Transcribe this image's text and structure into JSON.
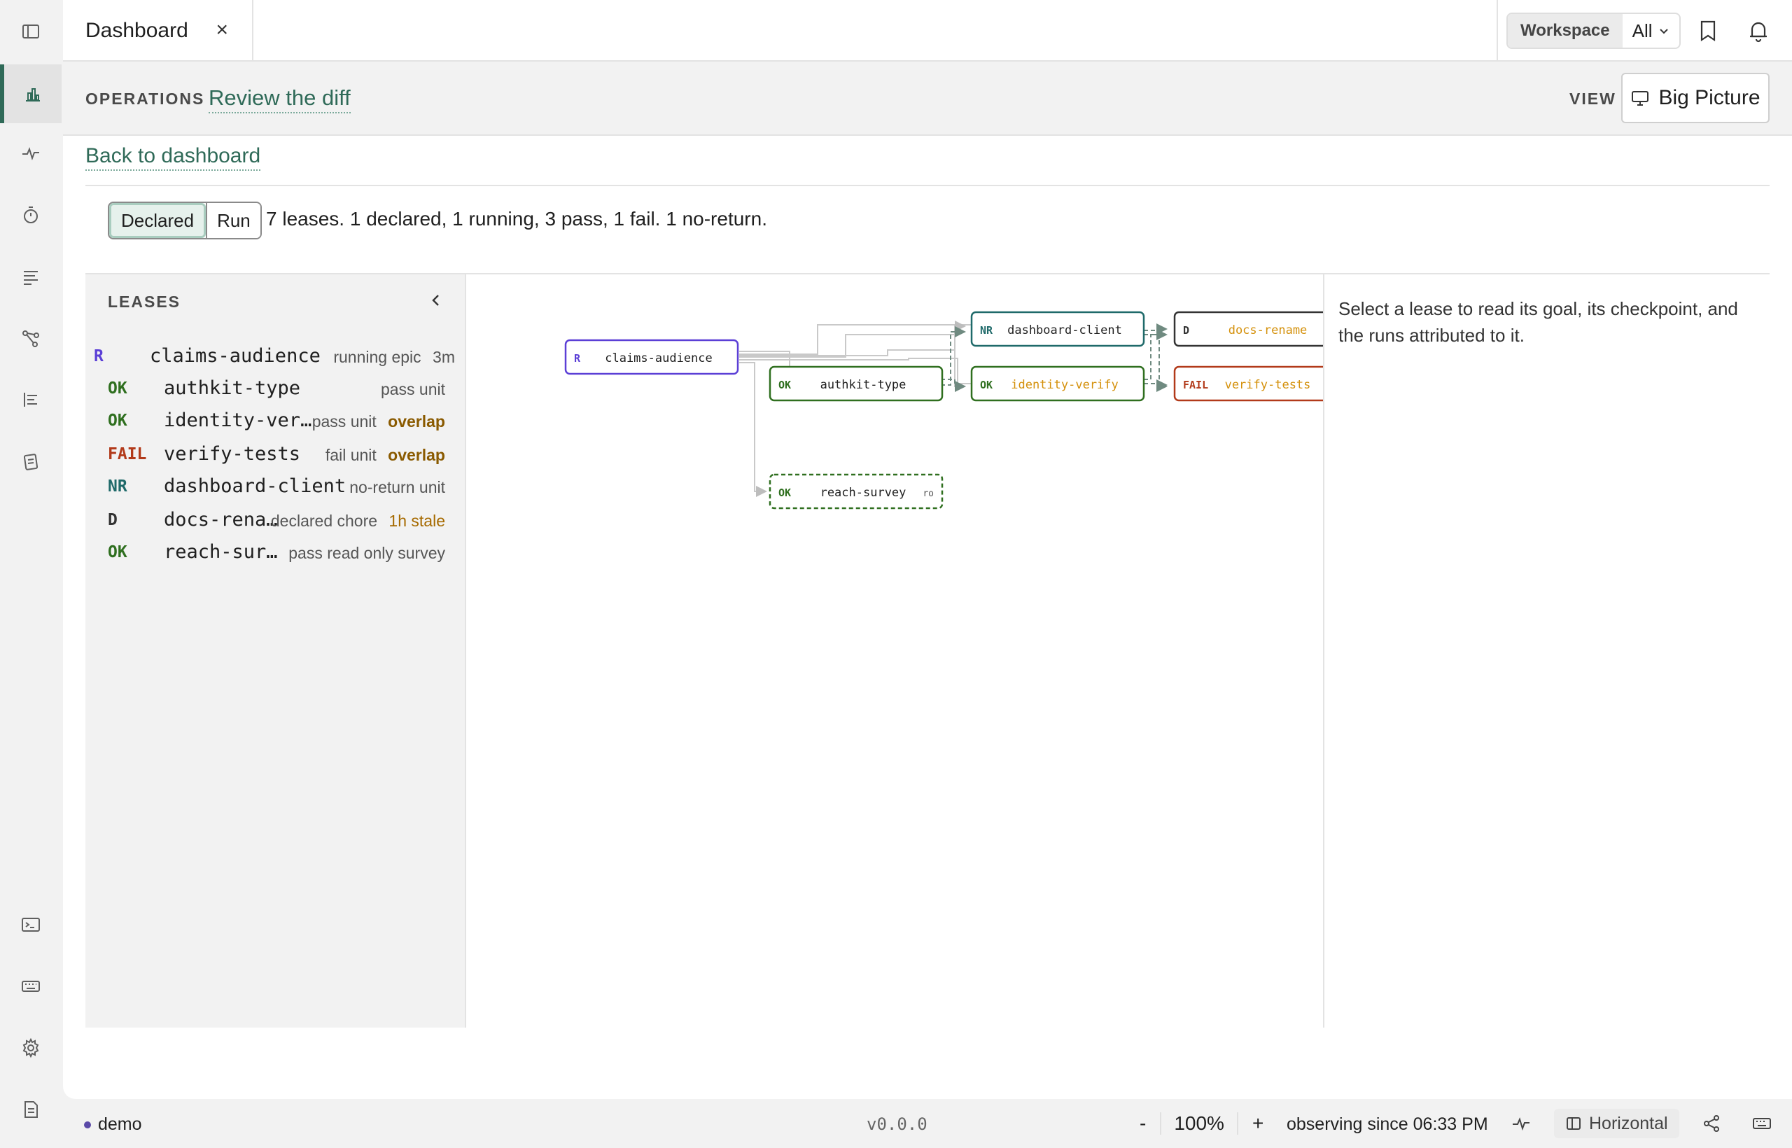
{
  "tab": {
    "title": "Dashboard",
    "close": "×"
  },
  "workspace": {
    "label": "Workspace",
    "value": "All"
  },
  "header": {
    "section": "OPERATIONS",
    "link": "Review the diff",
    "view_label": "VIEW",
    "view_button": "Big Picture"
  },
  "back_link": "Back to dashboard",
  "mode": {
    "declared": "Declared",
    "run": "Run",
    "active": "Declared"
  },
  "summary": "7 leases. 1 declared, 1 running, 3 pass, 1 fail. 1 no-return.",
  "leases": {
    "heading": "LEASES",
    "items": [
      {
        "status": "R",
        "name": "claims-audience",
        "meta": "running epic",
        "extra": "3m",
        "extra_kind": "plain"
      },
      {
        "status": "OK",
        "name": "authkit-type",
        "meta": "pass unit",
        "extra": "",
        "extra_kind": ""
      },
      {
        "status": "OK",
        "name": "identity-ver…",
        "meta": "pass unit",
        "extra": "overlap",
        "extra_kind": "bold"
      },
      {
        "status": "FAIL",
        "name": "verify-tests",
        "meta": "fail unit",
        "extra": "overlap",
        "extra_kind": "bold"
      },
      {
        "status": "NR",
        "name": "dashboard-client",
        "meta": "no-return unit",
        "extra": "",
        "extra_kind": ""
      },
      {
        "status": "D",
        "name": "docs-rena…",
        "meta": "declared chore",
        "extra": "1h stale",
        "extra_kind": "stale"
      },
      {
        "status": "OK",
        "name": "reach-sur…",
        "meta": "pass read only survey",
        "extra": "",
        "extra_kind": ""
      }
    ]
  },
  "graph": {
    "nodes": [
      {
        "id": "claims-audience",
        "status": "R",
        "label": "claims-audience",
        "tag": ""
      },
      {
        "id": "authkit-type",
        "status": "OK",
        "label": "authkit-type",
        "tag": ""
      },
      {
        "id": "dashboard-client",
        "status": "NR",
        "label": "dashboard-client",
        "tag": ""
      },
      {
        "id": "identity-verify",
        "status": "OK",
        "label": "identity-verify",
        "tag": ""
      },
      {
        "id": "docs-rename",
        "status": "D",
        "label": "docs-rename",
        "tag": ""
      },
      {
        "id": "verify-tests",
        "status": "FAIL",
        "label": "verify-tests",
        "tag": ""
      },
      {
        "id": "reach-survey",
        "status": "OK",
        "label": "reach-survey",
        "tag": "ro"
      }
    ]
  },
  "detail": {
    "hint": "Select a lease to read its goal, its checkpoint, and the runs attributed to it."
  },
  "status_bar": {
    "env": "demo",
    "version": "v0.0.0",
    "zoom_out": "-",
    "zoom": "100%",
    "zoom_in": "+",
    "observing": "observing since 06:33 PM",
    "layout": "Horizontal"
  },
  "colors": {
    "accent": "#2f6a58",
    "running": "#5b3fd6",
    "pass": "#2f6f1f",
    "fail": "#b23a1a",
    "noreturn": "#1f6a6a",
    "declared": "#333333",
    "highlight_text": "#d4900a"
  }
}
